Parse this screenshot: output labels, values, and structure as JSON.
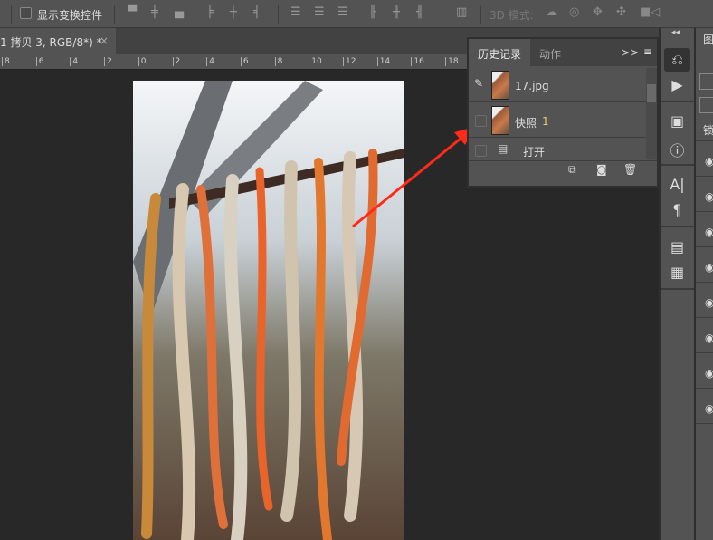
{
  "options_bar": {
    "show_transform_label": "显示变换控件",
    "mode_3d_label": "3D 模式:"
  },
  "document_tab": {
    "title": "1 拷贝 3, RGB/8*) *",
    "close": "×"
  },
  "ruler": {
    "ticks": [
      "8",
      "6",
      "4",
      "2",
      "0",
      "2",
      "4",
      "6",
      "8",
      "10",
      "12",
      "14",
      "16",
      "18"
    ]
  },
  "history_panel": {
    "tabs": [
      "历史记录",
      "动作"
    ],
    "expand": ">>",
    "menu": "≡",
    "items": [
      {
        "label": "17.jpg",
        "badge": ""
      },
      {
        "label": "快照",
        "badge": "1"
      },
      {
        "label": "打开",
        "badge": ""
      }
    ]
  },
  "layers_panel": {
    "tab_partial": "图",
    "lock_partial": "锁"
  },
  "colors": {
    "bg": "#282828",
    "panel": "#535353",
    "arrow": "#ff2a1a"
  }
}
